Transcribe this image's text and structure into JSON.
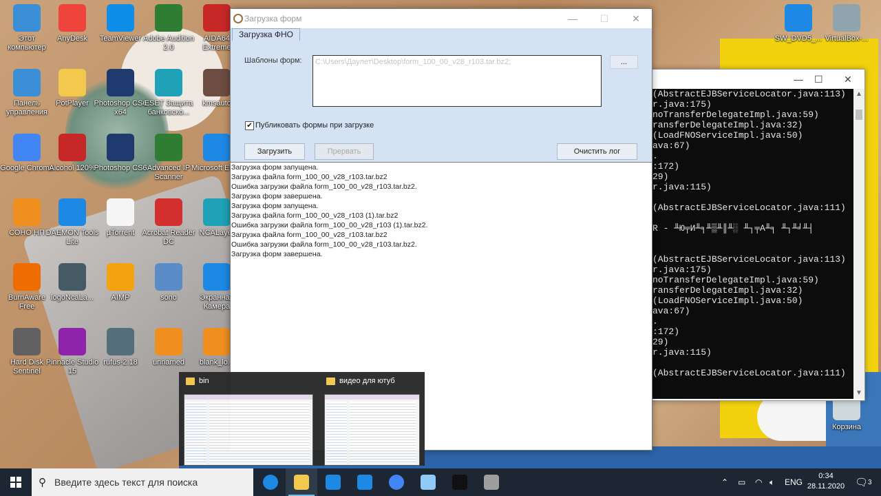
{
  "desktop_icons": [
    {
      "label": "Этот компьютер",
      "icon": "monitor-icon",
      "color": "#3a8fd6"
    },
    {
      "label": "AnyDesk",
      "icon": "anydesk-icon",
      "color": "#ef443b"
    },
    {
      "label": "TeamViewer",
      "icon": "teamviewer-icon",
      "color": "#0e8ee9"
    },
    {
      "label": "Adobe Audition 2.0",
      "icon": "audition-icon",
      "color": "#2e7d32"
    },
    {
      "label": "AIDA64 Extreme",
      "icon": "aida64-icon",
      "color": "#c62828"
    },
    {
      "label": "Панель управления",
      "icon": "control-panel-icon",
      "color": "#3a8fd6"
    },
    {
      "label": "PotPlayer",
      "icon": "potplayer-icon",
      "color": "#f2c94c"
    },
    {
      "label": "Photoshop CS6 x64",
      "icon": "photoshop-icon",
      "color": "#1e3a6e"
    },
    {
      "label": "ESET Защита банковско...",
      "icon": "eset-icon",
      "color": "#1fa2b7"
    },
    {
      "label": "kmsauto",
      "icon": "kmsauto-icon",
      "color": "#6d4c41"
    },
    {
      "label": "Google Chrome",
      "icon": "chrome-icon",
      "color": "#4285f4"
    },
    {
      "label": "Alcohol 120%",
      "icon": "alcohol-icon",
      "color": "#c62828"
    },
    {
      "label": "Photoshop CS6",
      "icon": "photoshop-icon",
      "color": "#1e3a6e"
    },
    {
      "label": "Advanced IP Scanner",
      "icon": "ip-scanner-icon",
      "color": "#2e7d32"
    },
    {
      "label": "Microsoft Edge",
      "icon": "edge-icon",
      "color": "#1e88e5"
    },
    {
      "label": "СОНО НП",
      "icon": "sono-icon",
      "color": "#ef8f1f"
    },
    {
      "label": "DAEMON Tools Lite",
      "icon": "daemon-tools-icon",
      "color": "#1e88e5"
    },
    {
      "label": "µTorrent",
      "icon": "utorrent-icon",
      "color": "#f5f5f5"
    },
    {
      "label": "Acrobat Reader DC",
      "icon": "acrobat-icon",
      "color": "#d32f2f"
    },
    {
      "label": "NCALayer",
      "icon": "ncalayer-icon",
      "color": "#1fa2b7"
    },
    {
      "label": "BurnAware Free",
      "icon": "burnaware-icon",
      "color": "#ef6c00"
    },
    {
      "label": "logoNcaLa...",
      "icon": "ncalayer-logo-icon",
      "color": "#455a64"
    },
    {
      "label": "AIMP",
      "icon": "aimp-icon",
      "color": "#f2a30f"
    },
    {
      "label": "sono",
      "icon": "folder-icon",
      "color": "#5c8cc7"
    },
    {
      "label": "Экранная Камера",
      "icon": "screen-camera-icon",
      "color": "#1e88e5"
    },
    {
      "label": "Hard Disk Sentinel",
      "icon": "hdd-sentinel-icon",
      "color": "#616161"
    },
    {
      "label": "Pinnacle Studio 15",
      "icon": "pinnacle-icon",
      "color": "#8e24aa"
    },
    {
      "label": "rufus-2.18",
      "icon": "usb-icon",
      "color": "#546e7a"
    },
    {
      "label": "unnamed",
      "icon": "sono-icon",
      "color": "#ef8f1f"
    },
    {
      "label": "blank_lo...",
      "icon": "sono-icon",
      "color": "#ef8f1f"
    }
  ],
  "right_icons": [
    {
      "label": "SW_DVD5_...",
      "icon": "daemon-tools-icon",
      "color": "#1e88e5"
    },
    {
      "label": "VirtualBox-...",
      "icon": "virtualbox-icon",
      "color": "#90a4ae"
    },
    {
      "label": "Корзина",
      "icon": "recycle-bin-icon",
      "color": "#cfd8dc"
    }
  ],
  "console": {
    "lines": [
      "(AbstractEJBServiceLocator.java:113)",
      "r.java:175)",
      "noTransferDelegateImpl.java:59)",
      "ransferDelegateImpl.java:32)",
      "(LoadFNOServiceImpl.java:50)",
      "ava:67)",
      ".",
      ":172)",
      "29)",
      "r.java:115)",
      "",
      "(AbstractEJBServiceLocator.java:111)",
      "",
      "R - ╨Ю╤И╨╕╨▒╨║╨░ ╨┐╤А╨╕ ╨┐╨╛╨┤",
      "",
      "",
      "(AbstractEJBServiceLocator.java:113)",
      "r.java:175)",
      "noTransferDelegateImpl.java:59)",
      "ransferDelegateImpl.java:32)",
      "(LoadFNOServiceImpl.java:50)",
      "ava:67)",
      ".",
      ":172)",
      "29)",
      "r.java:115)",
      "",
      "(AbstractEJBServiceLocator.java:111)"
    ]
  },
  "dialog": {
    "title": "Загрузка форм",
    "tab": "Загрузка ФНО",
    "templates_label": "Шаблоны форм:",
    "templates_value": "C:\\Users\\Даулет\\Desktop\\form_100_00_v28_r103.tar.bz2;",
    "browse_label": "...",
    "publish_label": "Публиковать формы при загрузке",
    "publish_checked": "✔",
    "load_button": "Загрузить",
    "abort_button": "Прервать",
    "clear_button": "Очистить лог",
    "log": [
      "Загрузка форм запущена.",
      "Загрузка файла form_100_00_v28_r103.tar.bz2",
      "Ошибка загрузки файла form_100_00_v28_r103.tar.bz2.",
      "Загрузка форм завершена.",
      "Загрузка форм запущена.",
      "Загрузка файла form_100_00_v28_r103 (1).tar.bz2",
      "Ошибка загрузки файла form_100_00_v28_r103 (1).tar.bz2.",
      "Загрузка файла form_100_00_v28_r103.tar.bz2",
      "Ошибка загрузки файла form_100_00_v28_r103.tar.bz2.",
      "Загрузка форм завершена."
    ]
  },
  "thumbnails": [
    {
      "name": "bin"
    },
    {
      "name": "видео для ютуб"
    }
  ],
  "taskbar": {
    "search_placeholder": "Введите здесь текст для поиска",
    "apps": [
      {
        "name": "edge",
        "icon": "edge-icon",
        "color": "#1e88e5"
      },
      {
        "name": "explorer",
        "icon": "file-explorer-icon",
        "color": "#f2c94c"
      },
      {
        "name": "store",
        "icon": "store-icon",
        "color": "#1e88e5"
      },
      {
        "name": "mail",
        "icon": "mail-icon",
        "color": "#1e88e5"
      },
      {
        "name": "chrome",
        "icon": "chrome-icon",
        "color": "#4285f4"
      },
      {
        "name": "computer",
        "icon": "monitor-icon",
        "color": "#90caf9"
      },
      {
        "name": "cmd",
        "icon": "console-icon",
        "color": "#111111"
      },
      {
        "name": "sono",
        "icon": "sono-icon",
        "color": "#9e9e9e"
      }
    ],
    "language": "ENG",
    "time": "0:34",
    "date": "28.11.2020",
    "notification_count": "3"
  }
}
